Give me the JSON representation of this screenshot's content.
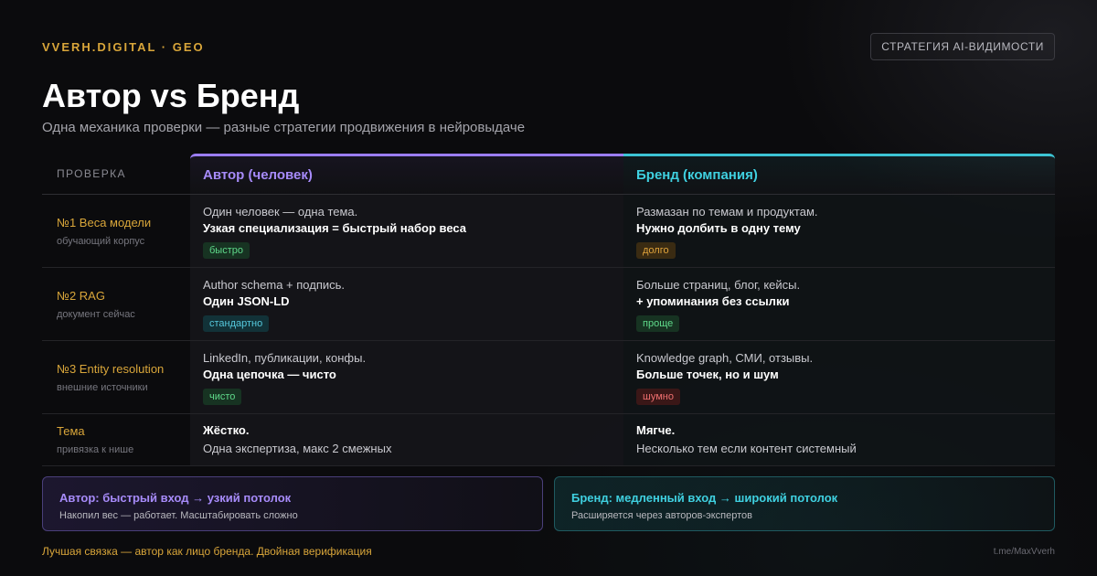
{
  "header": {
    "brand": "VVERH.DIGITAL · GEO",
    "tag": "СТРАТЕГИЯ AI-ВИДИМОСТИ",
    "title": "Автор vs Бренд",
    "subtitle": "Одна механика проверки — разные стратегии продвижения в нейровыдаче"
  },
  "table": {
    "col_label": "ПРОВЕРКА",
    "col_a": "Автор (человек)",
    "col_b": "Бренд (компания)",
    "rows": [
      {
        "label": "№1 Веса модели",
        "sublabel": "обучающий корпус",
        "a_line1": "Один человек — одна тема.",
        "a_line2": "Узкая специализация = быстрый набор веса",
        "a_badge": "быстро",
        "b_line1": "Размазан по темам и продуктам.",
        "b_line2": "Нужно долбить в одну тему",
        "b_badge": "долго"
      },
      {
        "label": "№2 RAG",
        "sublabel": "документ сейчас",
        "a_line1": "Author schema + подпись.",
        "a_line2": "Один JSON-LD",
        "a_badge": "стандартно",
        "b_line1": "Больше страниц, блог, кейсы.",
        "b_line2": "+ упоминания без ссылки",
        "b_badge": "проще"
      },
      {
        "label": "№3 Entity resolution",
        "sublabel": "внешние источники",
        "a_line1": "LinkedIn, публикации, конфы.",
        "a_line2": "Одна цепочка — чисто",
        "a_badge": "чисто",
        "b_line1": "Knowledge graph, СМИ, отзывы.",
        "b_line2": "Больше точек, но и шум",
        "b_badge": "шумно"
      },
      {
        "label": "Тема",
        "sublabel": "привязка к нише",
        "a_line1": "Жёстко.",
        "a_line2": "Одна экспертиза, макс 2 смежных",
        "b_line1": "Мягче.",
        "b_line2": "Несколько тем если контент системный"
      }
    ]
  },
  "cards": {
    "a_title": "Автор: быстрый вход → узкий потолок",
    "a_text": "Накопил вес — работает. Масштабировать сложно",
    "b_title": "Бренд: медленный вход → широкий потолок",
    "b_text": "Расширяется через авторов-экспертов"
  },
  "footer": {
    "text": "Лучшая связка — автор как лицо бренда. Двойная верификация",
    "handle": "t.me/MaxVverh"
  },
  "colors": {
    "accent_gold": "#d9a63a",
    "author_purple": "#a78bfa",
    "brand_cyan": "#3fd0e0"
  }
}
